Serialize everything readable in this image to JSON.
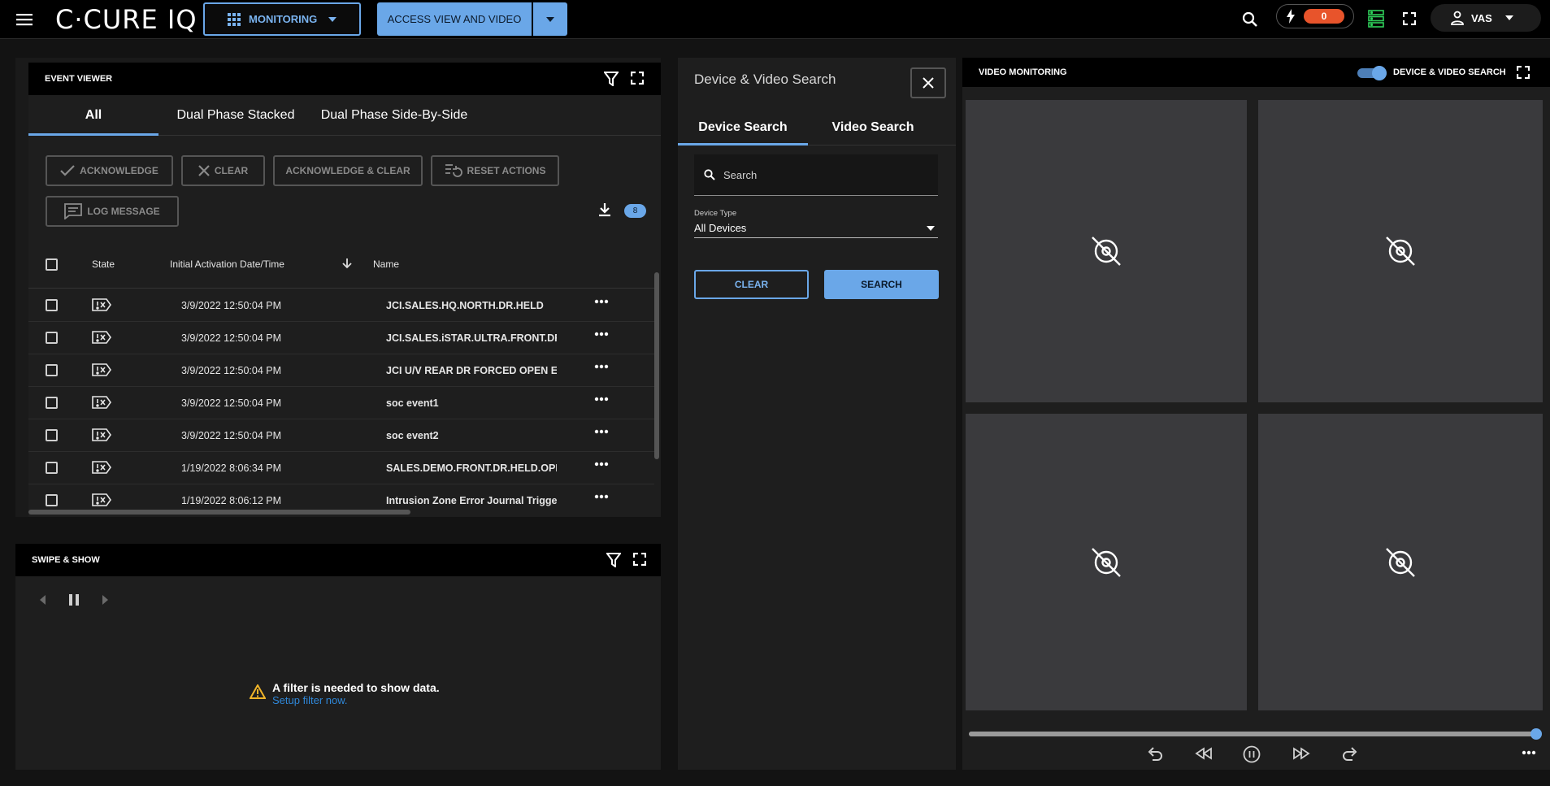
{
  "app": {
    "logo": "C·CURE IQ",
    "monitoring_label": "MONITORING",
    "access_label": "ACCESS VIEW AND VIDEO",
    "alarm_count": "0",
    "user": "VAS",
    "colors": {
      "accent": "#6aa7e8",
      "alarm": "#e8542b",
      "server": "#2fd05a",
      "link": "#2f87d8"
    }
  },
  "event_viewer": {
    "title": "EVENT VIEWER",
    "tabs": [
      "All",
      "Dual Phase Stacked",
      "Dual Phase Side-By-Side"
    ],
    "active_tab": "All",
    "actions": {
      "acknowledge": "ACKNOWLEDGE",
      "clear": "CLEAR",
      "ack_clear": "ACKNOWLEDGE & CLEAR",
      "reset": "RESET ACTIONS",
      "log": "LOG MESSAGE"
    },
    "count": "8",
    "columns": {
      "state": "State",
      "date": "Initial Activation Date/Time",
      "name": "Name"
    },
    "rows": [
      {
        "date": "3/9/2022 12:50:04 PM",
        "name": "JCI.SALES.HQ.NORTH.DR.HELD"
      },
      {
        "date": "3/9/2022 12:50:04 PM",
        "name": "JCI.SALES.iSTAR.ULTRA.FRONT.DR."
      },
      {
        "date": "3/9/2022 12:50:04 PM",
        "name": "JCI U/V REAR DR FORCED OPEN EV"
      },
      {
        "date": "3/9/2022 12:50:04 PM",
        "name": "soc event1"
      },
      {
        "date": "3/9/2022 12:50:04 PM",
        "name": "soc event2"
      },
      {
        "date": "1/19/2022 8:06:34 PM",
        "name": "SALES.DEMO.FRONT.DR.HELD.OPEN"
      },
      {
        "date": "1/19/2022 8:06:12 PM",
        "name": "Intrusion Zone Error Journal Trigger"
      }
    ]
  },
  "swipe_show": {
    "title": "SWIPE & SHOW",
    "message": "A filter is needed to show data.",
    "link": "Setup filter now."
  },
  "device_search": {
    "title": "Device & Video Search",
    "tabs": [
      "Device Search",
      "Video Search"
    ],
    "active_tab": "Device Search",
    "search_placeholder": "Search",
    "device_type_label": "Device Type",
    "device_type_value": "All Devices",
    "clear_label": "CLEAR",
    "search_label": "SEARCH"
  },
  "video_monitoring": {
    "title": "VIDEO MONITORING",
    "toggle_label": "DEVICE & VIDEO SEARCH",
    "toggle_on": true,
    "tiles": 4,
    "progress": 0.99
  }
}
